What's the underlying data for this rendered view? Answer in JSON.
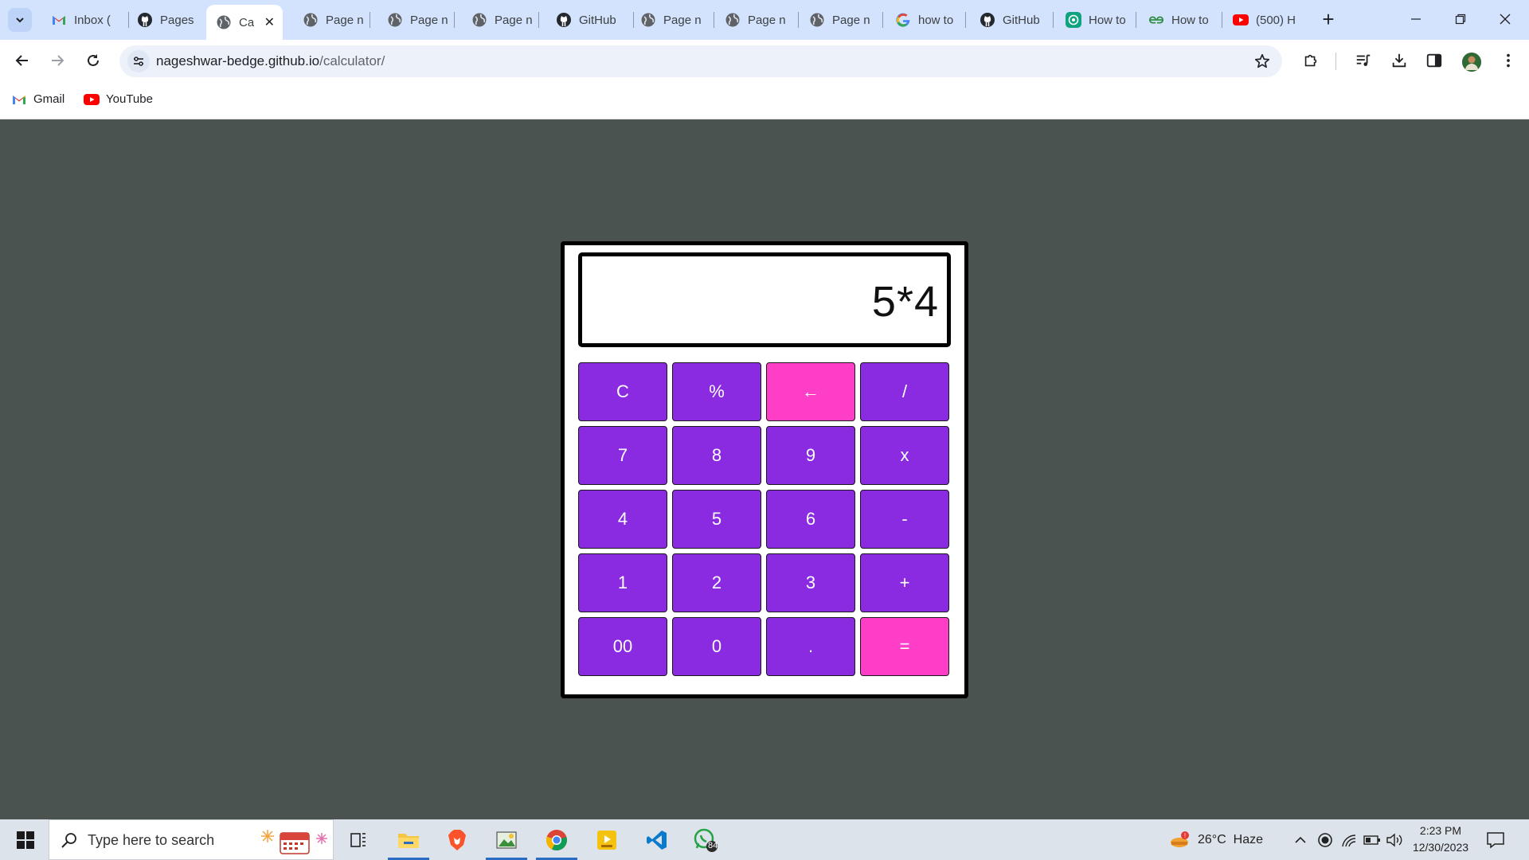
{
  "browser": {
    "tabs": [
      {
        "label": "Inbox (",
        "icon": "gmail-icon"
      },
      {
        "label": "Pages",
        "icon": "github-icon"
      },
      {
        "label": "Ca",
        "icon": "globe-icon",
        "active": true
      },
      {
        "label": "Page n",
        "icon": "globe-icon"
      },
      {
        "label": "Page n",
        "icon": "globe-icon"
      },
      {
        "label": "Page n",
        "icon": "globe-icon"
      },
      {
        "label": "GitHub",
        "icon": "github-icon"
      },
      {
        "label": "Page n",
        "icon": "globe-icon"
      },
      {
        "label": "Page n",
        "icon": "globe-icon"
      },
      {
        "label": "Page n",
        "icon": "globe-icon"
      },
      {
        "label": "how to",
        "icon": "google-icon"
      },
      {
        "label": "GitHub",
        "icon": "github-icon"
      },
      {
        "label": "How to",
        "icon": "chatgpt-icon"
      },
      {
        "label": "How to",
        "icon": "geeksforgeeks-icon"
      },
      {
        "label": "(500) H",
        "icon": "youtube-icon"
      }
    ],
    "url_host": "nageshwar-bedge.github.io",
    "url_path": "/calculator/",
    "bookmarks": [
      {
        "label": "Gmail",
        "icon": "gmail-icon"
      },
      {
        "label": "YouTube",
        "icon": "youtube-icon"
      }
    ]
  },
  "calculator": {
    "display": "5*4",
    "keys": [
      {
        "label": "C",
        "accent": false
      },
      {
        "label": "%",
        "accent": false
      },
      {
        "label": "←",
        "accent": true
      },
      {
        "label": "/",
        "accent": false
      },
      {
        "label": "7",
        "accent": false
      },
      {
        "label": "8",
        "accent": false
      },
      {
        "label": "9",
        "accent": false
      },
      {
        "label": "x",
        "accent": false
      },
      {
        "label": "4",
        "accent": false
      },
      {
        "label": "5",
        "accent": false
      },
      {
        "label": "6",
        "accent": false
      },
      {
        "label": "-",
        "accent": false
      },
      {
        "label": "1",
        "accent": false
      },
      {
        "label": "2",
        "accent": false
      },
      {
        "label": "3",
        "accent": false
      },
      {
        "label": "+",
        "accent": false
      },
      {
        "label": "00",
        "accent": false
      },
      {
        "label": "0",
        "accent": false
      },
      {
        "label": ".",
        "accent": false
      },
      {
        "label": "=",
        "accent": true
      }
    ],
    "colors": {
      "key": "#8a2be2",
      "accent": "#ff3ec7",
      "background": "#4b5351"
    }
  },
  "taskbar": {
    "search_placeholder": "Type here to search",
    "weather": "26°C  Haze",
    "whatsapp_badge": "84",
    "time": "2:23 PM",
    "date": "12/30/2023"
  }
}
